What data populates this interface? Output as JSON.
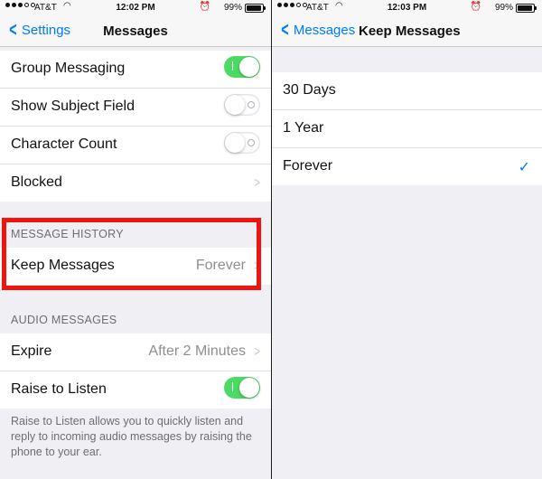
{
  "status": {
    "carrier": "AT&T",
    "battery": "99%",
    "left_time": "12:02 PM",
    "right_time": "12:03 PM"
  },
  "left": {
    "back_label": "Settings",
    "title": "Messages",
    "top_cells": [
      {
        "label": "Group Messaging",
        "toggle": "on"
      },
      {
        "label": "Show Subject Field",
        "toggle": "off"
      },
      {
        "label": "Character Count",
        "toggle": "off"
      },
      {
        "label": "Blocked"
      }
    ],
    "message_history": {
      "header": "MESSAGE HISTORY",
      "keep_messages_label": "Keep Messages",
      "keep_messages_value": "Forever"
    },
    "audio_messages": {
      "header": "AUDIO MESSAGES",
      "expire_label": "Expire",
      "expire_value": "After 2 Minutes",
      "raise_label": "Raise to Listen",
      "raise_toggle": "on",
      "footer": "Raise to Listen allows you to quickly listen and reply to incoming audio messages by raising the phone to your ear."
    },
    "highlight_color": "#f0140e"
  },
  "right": {
    "back_label": "Messages",
    "title": "Keep Messages",
    "options": [
      "30 Days",
      "1 Year",
      "Forever"
    ],
    "selected": "Forever"
  },
  "colors": {
    "accent": "#007aff",
    "toggle_on": "#4cd964",
    "background": "#efeff4"
  },
  "icons": [
    "signal-dots-icon",
    "wifi-icon",
    "alarm-icon",
    "battery-icon",
    "chevron-left-icon",
    "chevron-right-icon",
    "checkmark-icon"
  ]
}
